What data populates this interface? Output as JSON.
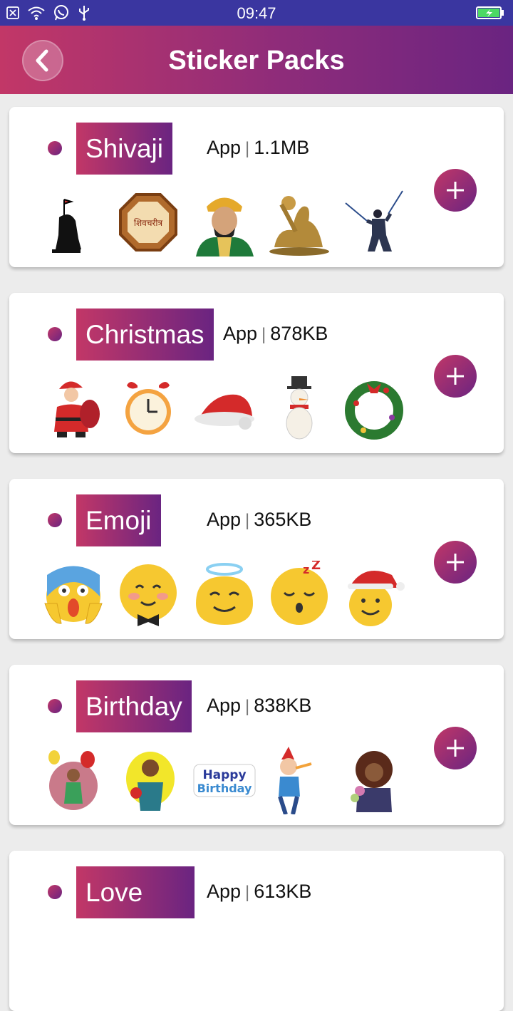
{
  "status": {
    "time": "09:47"
  },
  "header": {
    "title": "Sticker Packs"
  },
  "packs": [
    {
      "name": "Shivaji",
      "source": "App",
      "size": "1.1MB",
      "stickers": [
        "maratha-statue-sticker",
        "shivcharitra-seal-sticker",
        "shivaji-portrait-sticker",
        "bronze-statue-sticker",
        "sword-warrior-sticker"
      ]
    },
    {
      "name": "Christmas",
      "source": "App",
      "size": "878KB",
      "stickers": [
        "santa-claus-sticker",
        "alarm-clock-sticker",
        "santa-hat-sticker",
        "snowman-sticker",
        "christmas-wreath-sticker"
      ]
    },
    {
      "name": "Emoji",
      "source": "App",
      "size": "365KB",
      "stickers": [
        "screaming-face-sticker",
        "blushing-bowtie-face-sticker",
        "angel-face-sticker",
        "sleeping-face-sticker",
        "santa-smiley-sticker"
      ]
    },
    {
      "name": "Birthday",
      "source": "App",
      "size": "838KB",
      "stickers": [
        "balloon-girl-sticker",
        "girl-flowers-sticker",
        "happy-birthday-text-sticker",
        "party-boy-sticker",
        "curly-hair-girl-sticker"
      ],
      "text_sticker": [
        "Happy",
        "Birthday"
      ]
    },
    {
      "name": "Love",
      "source": "App",
      "size": "613KB",
      "stickers": []
    }
  ],
  "colors": {
    "primary": "#c23767",
    "secondary": "#6a2481",
    "status_bar": "#3a36a0"
  }
}
